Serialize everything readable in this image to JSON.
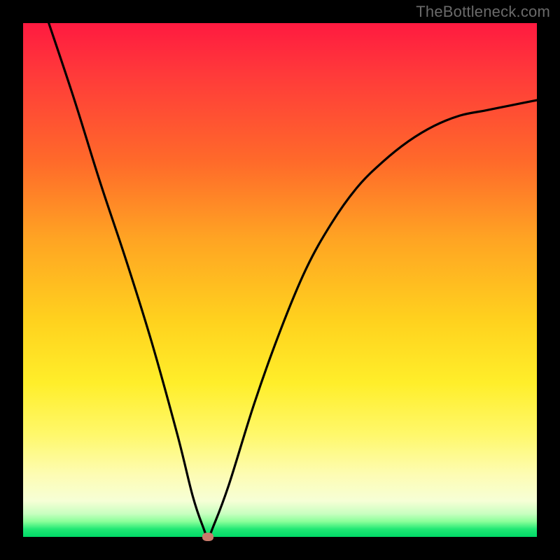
{
  "watermark": "TheBottleneck.com",
  "colors": {
    "frame": "#000000",
    "gradient_top": "#ff1a40",
    "gradient_mid_orange": "#ff9a25",
    "gradient_mid_yellow": "#ffee2a",
    "gradient_pale": "#fdfcb4",
    "gradient_green": "#00d967",
    "curve": "#000000",
    "marker": "#c97a6b"
  },
  "chart_data": {
    "type": "line",
    "title": "",
    "xlabel": "",
    "ylabel": "",
    "xlim": [
      0,
      100
    ],
    "ylim": [
      0,
      100
    ],
    "series": [
      {
        "name": "bottleneck-curve",
        "x": [
          5,
          10,
          15,
          20,
          25,
          30,
          33,
          35,
          36,
          37,
          40,
          45,
          50,
          55,
          60,
          65,
          70,
          75,
          80,
          85,
          90,
          95,
          100
        ],
        "y": [
          100,
          85,
          69,
          54,
          38,
          20,
          8,
          2,
          0,
          2,
          10,
          26,
          40,
          52,
          61,
          68,
          73,
          77,
          80,
          82,
          83,
          84,
          85
        ]
      }
    ],
    "marker": {
      "x": 36,
      "y": 0,
      "name": "optimal-point"
    },
    "annotations": []
  }
}
